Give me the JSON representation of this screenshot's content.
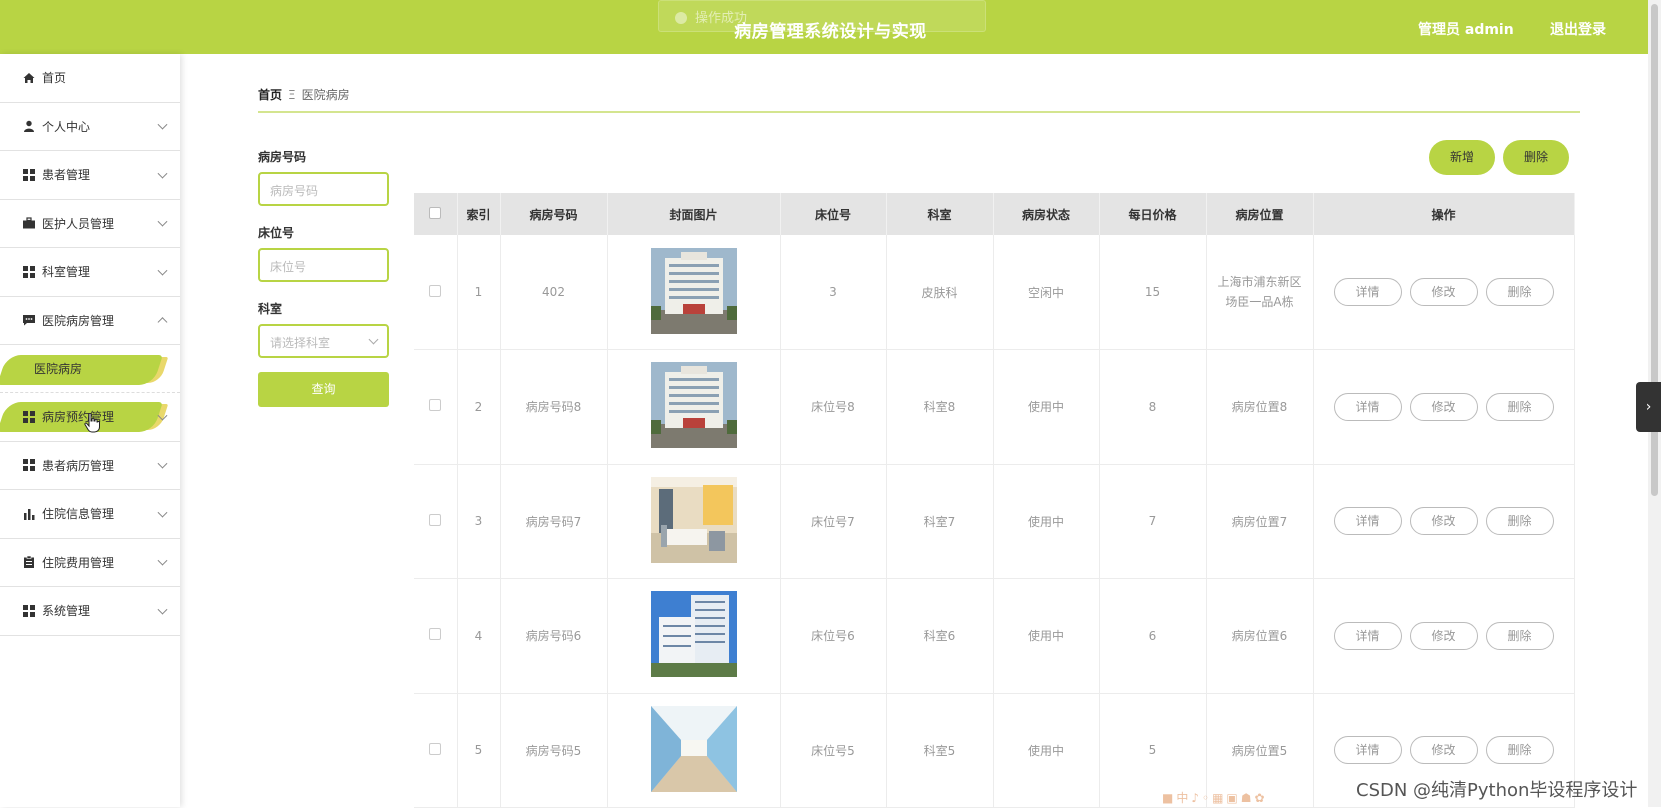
{
  "header": {
    "title": "病房管理系统设计与实现",
    "user": "管理员 admin",
    "logout": "退出登录",
    "toast": "操作成功"
  },
  "sidebar": {
    "items": [
      {
        "label": "首页",
        "icon": "home-icon"
      },
      {
        "label": "个人中心",
        "icon": "user-icon"
      },
      {
        "label": "患者管理",
        "icon": "grid-icon"
      },
      {
        "label": "医护人员管理",
        "icon": "briefcase-icon"
      },
      {
        "label": "科室管理",
        "icon": "grid-icon"
      },
      {
        "label": "医院病房管理",
        "icon": "message-icon",
        "expanded": true,
        "sub": [
          "医院病房"
        ]
      },
      {
        "label": "病房预约管理",
        "icon": "grid-icon"
      },
      {
        "label": "患者病历管理",
        "icon": "grid-icon"
      },
      {
        "label": "住院信息管理",
        "icon": "chart-icon"
      },
      {
        "label": "住院费用管理",
        "icon": "clipboard-icon"
      },
      {
        "label": "系统管理",
        "icon": "grid-icon"
      }
    ]
  },
  "breadcrumb": {
    "home": "首页",
    "current": "医院病房"
  },
  "search": {
    "room_label": "病房号码",
    "room_placeholder": "病房号码",
    "bed_label": "床位号",
    "bed_placeholder": "床位号",
    "dept_label": "科室",
    "dept_placeholder": "请选择科室",
    "query": "查询"
  },
  "toolbar": {
    "add": "新增",
    "delete": "删除"
  },
  "table": {
    "columns": [
      "索引",
      "病房号码",
      "封面图片",
      "床位号",
      "科室",
      "病房状态",
      "每日价格",
      "病房位置",
      "操作"
    ],
    "actions": [
      "详情",
      "修改",
      "删除"
    ],
    "rows": [
      {
        "index": "1",
        "room": "402",
        "image": "hospital-building-image",
        "bed": "3",
        "dept": "皮肤科",
        "status": "空闲中",
        "price": "15",
        "location": "上海市浦东新区场臣一品A栋"
      },
      {
        "index": "2",
        "room": "病房号码8",
        "image": "hospital-building-image",
        "bed": "床位号8",
        "dept": "科室8",
        "status": "使用中",
        "price": "8",
        "location": "病房位置8"
      },
      {
        "index": "3",
        "room": "病房号码7",
        "image": "ward-room-image",
        "bed": "床位号7",
        "dept": "科室7",
        "status": "使用中",
        "price": "7",
        "location": "病房位置7"
      },
      {
        "index": "4",
        "room": "病房号码6",
        "image": "hospital-tower-image",
        "bed": "床位号6",
        "dept": "科室6",
        "status": "使用中",
        "price": "6",
        "location": "病房位置6"
      },
      {
        "index": "5",
        "room": "病房号码5",
        "image": "corridor-image",
        "bed": "床位号5",
        "dept": "科室5",
        "status": "使用中",
        "price": "5",
        "location": "病房位置5"
      }
    ]
  },
  "watermark": "CSDN @纯清Python毕设程序设计",
  "colors": {
    "accent": "#b8d444",
    "header_text": "#ffffff"
  }
}
